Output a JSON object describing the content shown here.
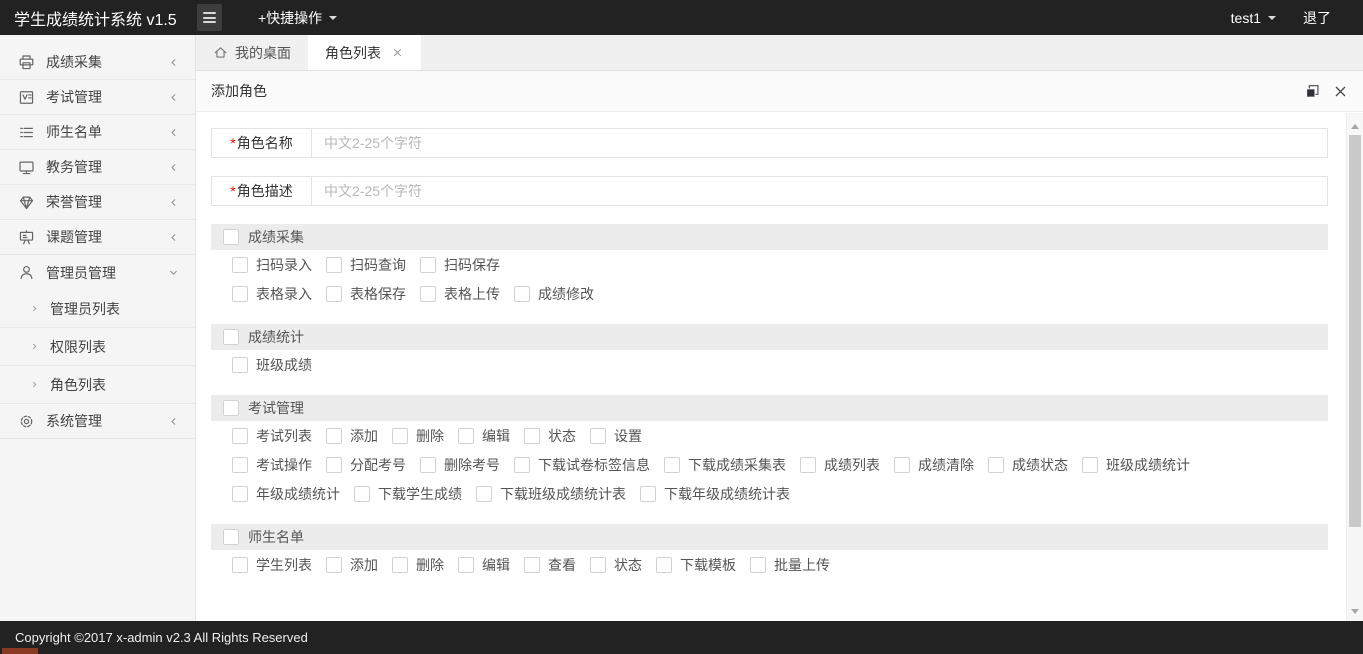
{
  "topbar": {
    "title": "学生成绩统计系统 v1.5",
    "quick_action_label": "+快捷操作",
    "username": "test1",
    "logout_label": "退了"
  },
  "sidebar": {
    "items": [
      {
        "id": "score-collection",
        "icon": "printer-icon",
        "label": "成绩采集",
        "expanded": false
      },
      {
        "id": "exam-management",
        "icon": "exam-icon",
        "label": "考试管理",
        "expanded": false
      },
      {
        "id": "teacher-student-roster",
        "icon": "list-icon",
        "label": "师生名单",
        "expanded": false
      },
      {
        "id": "academic-affairs",
        "icon": "monitor-icon",
        "label": "教务管理",
        "expanded": false
      },
      {
        "id": "honor-management",
        "icon": "gem-icon",
        "label": "荣誉管理",
        "expanded": false
      },
      {
        "id": "project-management",
        "icon": "board-icon",
        "label": "课题管理",
        "expanded": false
      },
      {
        "id": "admin-management",
        "icon": "user-icon",
        "label": "管理员管理",
        "expanded": true,
        "children": [
          {
            "id": "admin-list",
            "label": "管理员列表"
          },
          {
            "id": "permission-list",
            "label": "权限列表"
          },
          {
            "id": "role-list",
            "label": "角色列表"
          }
        ]
      },
      {
        "id": "system-management",
        "icon": "gear-icon",
        "label": "系统管理",
        "expanded": false
      }
    ]
  },
  "tabs": [
    {
      "id": "my-desktop",
      "label": "我的桌面",
      "icon": "home-icon",
      "active": false,
      "closable": false
    },
    {
      "id": "role-list",
      "label": "角色列表",
      "active": true,
      "closable": true
    }
  ],
  "panel": {
    "title": "添加角色"
  },
  "form": {
    "required_mark": "*",
    "fields": [
      {
        "id": "role-name",
        "label": "角色名称",
        "required": true,
        "value": "",
        "placeholder": "中文2-25个字符"
      },
      {
        "id": "role-desc",
        "label": "角色描述",
        "required": true,
        "value": "",
        "placeholder": "中文2-25个字符"
      }
    ],
    "permission_groups": [
      {
        "id": "score-collection",
        "title": "成绩采集",
        "checked": false,
        "rows": [
          [
            "扫码录入",
            "扫码查询",
            "扫码保存"
          ],
          [
            "表格录入",
            "表格保存",
            "表格上传",
            "成绩修改"
          ]
        ]
      },
      {
        "id": "score-statistics",
        "title": "成绩统计",
        "checked": false,
        "rows": [
          [
            "班级成绩"
          ]
        ]
      },
      {
        "id": "exam-management",
        "title": "考试管理",
        "checked": false,
        "rows": [
          [
            "考试列表",
            "添加",
            "删除",
            "编辑",
            "状态",
            "设置"
          ],
          [
            "考试操作",
            "分配考号",
            "删除考号",
            "下载试卷标签信息",
            "下载成绩采集表",
            "成绩列表",
            "成绩清除",
            "成绩状态",
            "班级成绩统计"
          ],
          [
            "年级成绩统计",
            "下载学生成绩",
            "下载班级成绩统计表",
            "下载年级成绩统计表"
          ]
        ]
      },
      {
        "id": "teacher-student-roster",
        "title": "师生名单",
        "checked": false,
        "rows": [
          [
            "学生列表",
            "添加",
            "删除",
            "编辑",
            "查看",
            "状态",
            "下载模板",
            "批量上传"
          ]
        ]
      }
    ]
  },
  "footer": {
    "copyright": "Copyright ©2017 x-admin v2.3 All Rights Reserved"
  },
  "colors": {
    "topbar_bg": "#222222",
    "footer_bg": "#222222",
    "sidebar_bg": "#f5f5f5",
    "tabbar_bg": "#f0f0f0",
    "active_tab_bg": "#ffffff",
    "section_header_bg": "#ececec",
    "checkbox_border": "#d2d2d2",
    "required_mark": "#ff0000",
    "placeholder": "#b8b8b8",
    "artifact_red": "#8a3a22"
  }
}
